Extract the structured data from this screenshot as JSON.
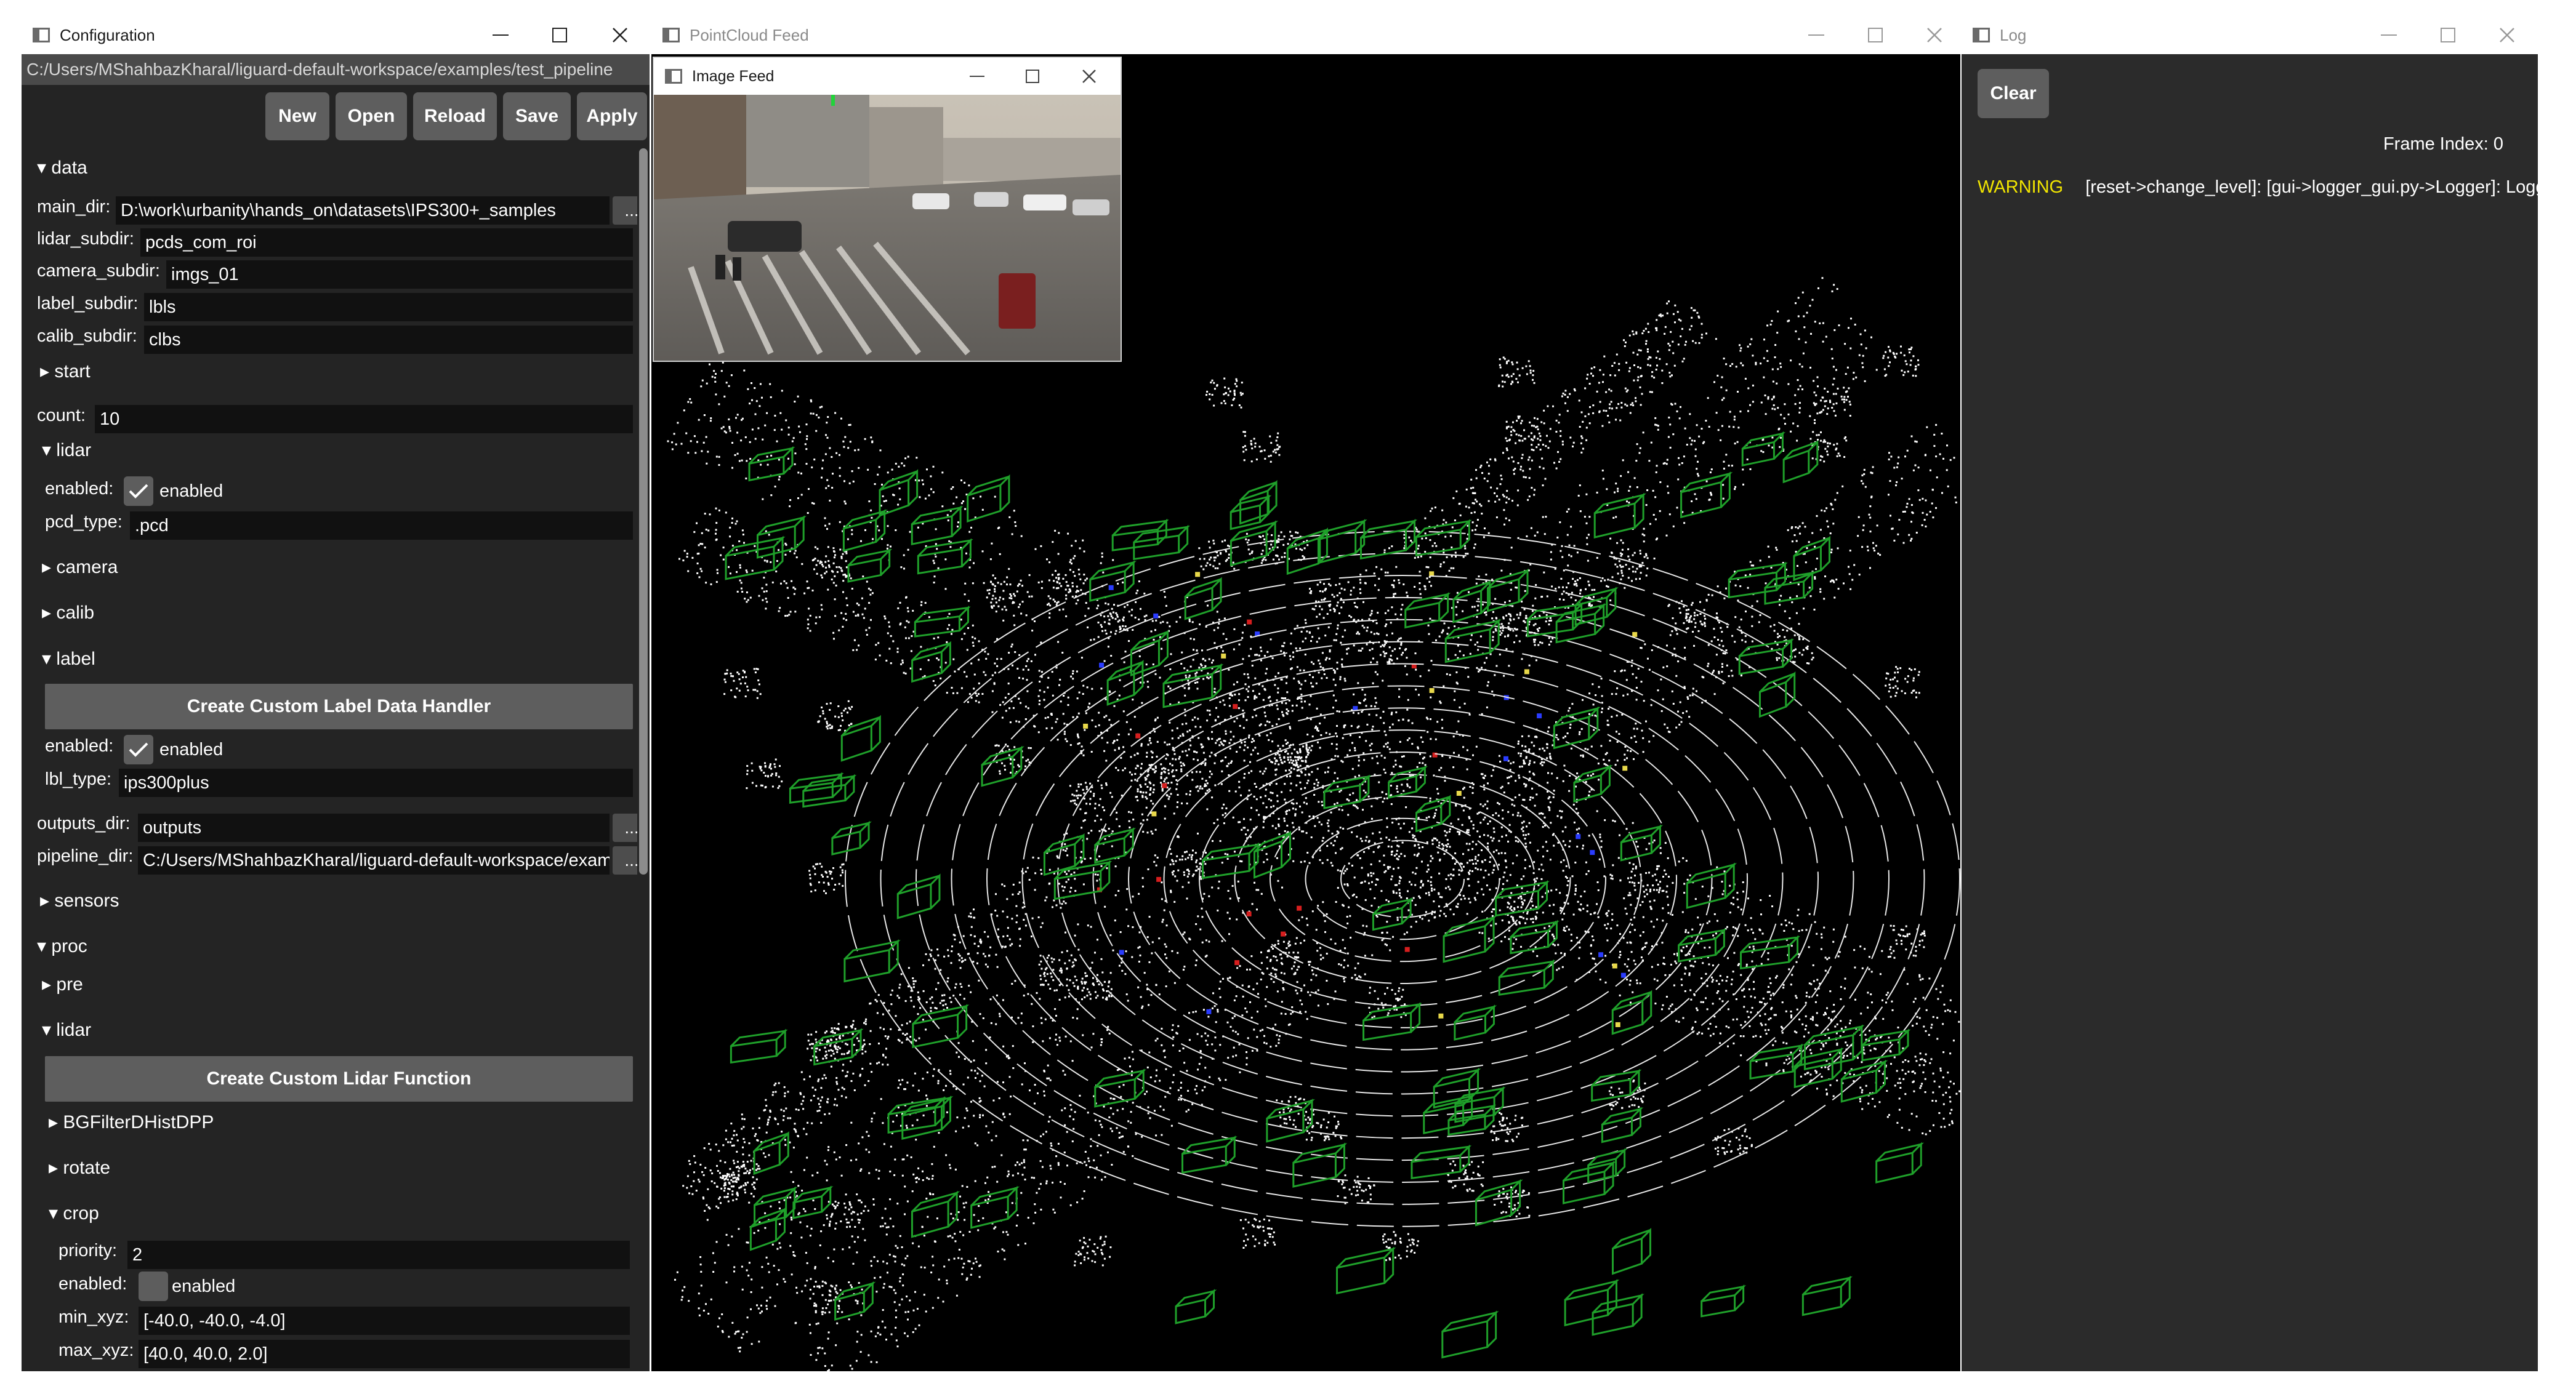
{
  "config": {
    "title": "Configuration",
    "path": "C:/Users/MShahbazKharal/liguard-default-workspace/examples/test_pipeline",
    "buttons": {
      "new": "New",
      "open": "Open",
      "reload": "Reload",
      "save": "Save",
      "apply": "Apply"
    },
    "browse": "...",
    "data": {
      "section": "data",
      "main_dir_label": "main_dir:",
      "main_dir": "D:\\work\\urbanity\\hands_on\\datasets\\IPS300+_samples",
      "lidar_subdir_label": "lidar_subdir:",
      "lidar_subdir": "pcds_com_roi",
      "camera_subdir_label": "camera_subdir:",
      "camera_subdir": "imgs_01",
      "label_subdir_label": "label_subdir:",
      "label_subdir": "lbls",
      "calib_subdir_label": "calib_subdir:",
      "calib_subdir": "clbs",
      "start_section": "start",
      "count_label": "count:",
      "count": "10",
      "lidar_section": "lidar",
      "lidar_enabled_label": "enabled:",
      "lidar_enabled_text": "enabled",
      "lidar_enabled": true,
      "pcd_type_label": "pcd_type:",
      "pcd_type": ".pcd",
      "camera_section": "camera",
      "calib_section": "calib",
      "label_section": "label",
      "create_label_handler": "Create Custom Label Data Handler",
      "label_enabled_label": "enabled:",
      "label_enabled_text": "enabled",
      "label_enabled": true,
      "lbl_type_label": "lbl_type:",
      "lbl_type": "ips300plus",
      "outputs_dir_label": "outputs_dir:",
      "outputs_dir": "outputs",
      "pipeline_dir_label": "pipeline_dir:",
      "pipeline_dir": "C:/Users/MShahbazKharal/liguard-default-workspace/examples/test_pipeline",
      "sensors_section": "sensors"
    },
    "proc": {
      "section": "proc",
      "pre_section": "pre",
      "lidar_section": "lidar",
      "create_lidar_function": "Create Custom Lidar Function",
      "bgfilter_section": "BGFilterDHistDPP",
      "rotate_section": "rotate",
      "crop_section": "crop",
      "priority_label": "priority:",
      "priority": "2",
      "crop_enabled_label": "enabled:",
      "crop_enabled_text": "enabled",
      "crop_enabled": false,
      "min_xyz_label": "min_xyz:",
      "min_xyz": "[-40.0, -40.0, -4.0]",
      "max_xyz_label": "max_xyz:",
      "max_xyz": "[40.0, 40.0, 2.0]"
    }
  },
  "pointcloud": {
    "title": "PointCloud Feed",
    "image_feed_title": "Image Feed",
    "colors": {
      "points": "#ffffff",
      "boxes": "#1fa02a",
      "background": "#000000"
    }
  },
  "log": {
    "title": "Log",
    "clear": "Clear",
    "frame_index": "Frame Index: 0",
    "entries": [
      {
        "level": "WARNING",
        "message": "[reset->change_level]: [gui->logger_gui.py->Logger]: Logg"
      }
    ],
    "warning_color": "#f2e600"
  }
}
